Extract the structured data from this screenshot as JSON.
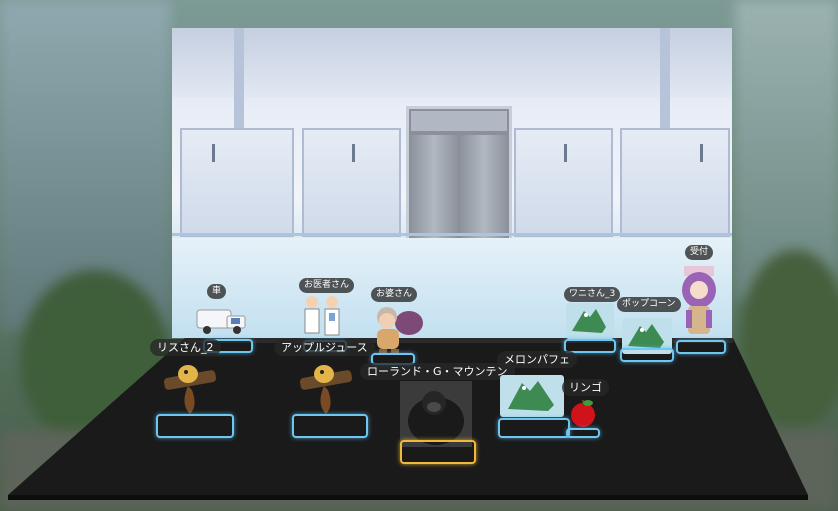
{
  "scene": {
    "type": "board-game-room",
    "background": "blurred-city-street",
    "backdrop": "hospital-corridor-elevator"
  },
  "pieces": [
    {
      "id": "car",
      "label": "車",
      "icon": "car-icon"
    },
    {
      "id": "doctors",
      "label": "お医者さん",
      "icon": "doctors-icon"
    },
    {
      "id": "grandma",
      "label": "お婆さん",
      "icon": "old-woman-icon"
    },
    {
      "id": "croc3",
      "label": "ワニさん_3",
      "icon": "crocodile-icon"
    },
    {
      "id": "popcorn",
      "label": "ポップコーン",
      "icon": "crocodile-icon"
    },
    {
      "id": "reception",
      "label": "受付",
      "icon": "receptionist-girl-icon"
    },
    {
      "id": "squirrel2",
      "label": "リスさん_2",
      "icon": "squirrel-icon"
    },
    {
      "id": "applejuice",
      "label": "アップルジュース",
      "icon": "squirrel-icon"
    },
    {
      "id": "gorilla",
      "label": "ローランド・G・マウンテン",
      "icon": "gorilla-icon"
    },
    {
      "id": "melon",
      "label": "メロンパフェ",
      "icon": "crocodile-icon"
    },
    {
      "id": "apple",
      "label": "リンゴ",
      "icon": "apple-icon"
    }
  ],
  "colors": {
    "frame_default": "#6fc6f0",
    "frame_selected": "#f0b93a",
    "floor": "#1c1c1c",
    "label_bg": "rgba(40,40,40,.78)"
  }
}
